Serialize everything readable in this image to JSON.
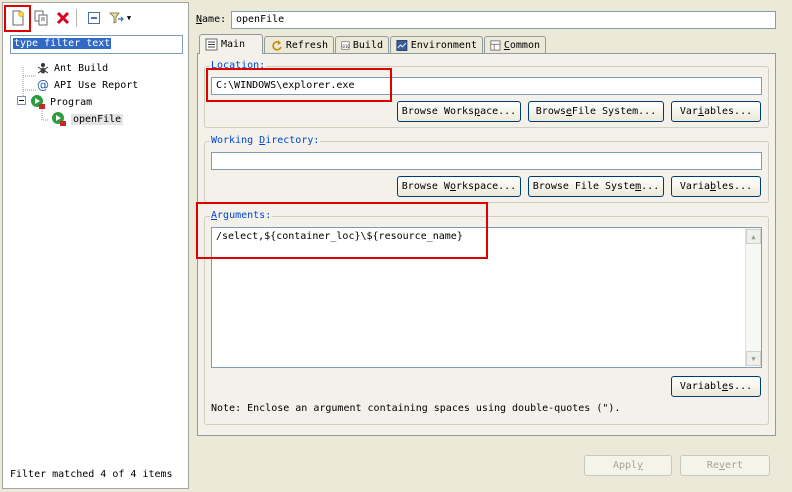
{
  "left": {
    "filter_placeholder": "type filter text",
    "tree": {
      "ant_build": "Ant Build",
      "api_use_report": "API Use Report",
      "program": "Program",
      "open_file": "openFile"
    },
    "status": "Filter matched 4 of 4 items"
  },
  "name": {
    "label_pre": "N",
    "label_post": "ame:",
    "value": "openFile"
  },
  "tabs": {
    "main": "Main",
    "refresh": "Refresh",
    "build": "Build",
    "environment": "Environment",
    "common_pre": "C",
    "common_post": "ommon"
  },
  "location": {
    "title_pre": "L",
    "title_post": "ocation:",
    "value": "C:\\WINDOWS\\explorer.exe",
    "btn_workspace_pre": "Browse Works",
    "btn_workspace_u": "p",
    "btn_workspace_post": "ace...",
    "btn_filesystem_pre": "Brows",
    "btn_filesystem_u": "e",
    "btn_filesystem_post": " File System...",
    "btn_variables_pre": "Var",
    "btn_variables_u": "i",
    "btn_variables_post": "ables..."
  },
  "working_dir": {
    "title_pre": "Working ",
    "title_u": "D",
    "title_post": "irectory:",
    "value": "",
    "btn_workspace_pre": "Browse W",
    "btn_workspace_u": "o",
    "btn_workspace_post": "rkspace...",
    "btn_filesystem_pre": "Browse File Syste",
    "btn_filesystem_u": "m",
    "btn_filesystem_post": "...",
    "btn_variables_pre": "Varia",
    "btn_variables_u": "b",
    "btn_variables_post": "les..."
  },
  "arguments": {
    "title_pre": "A",
    "title_post": "rguments:",
    "value": "/select,${container_loc}\\${resource_name}",
    "btn_variables_pre": "Variabl",
    "btn_variables_u": "e",
    "btn_variables_post": "s...",
    "note": "Note: Enclose an argument containing spaces using double-quotes (\")."
  },
  "footer": {
    "apply_pre": "Appl",
    "apply_u": "y",
    "apply_post": "",
    "revert_pre": "Re",
    "revert_u": "v",
    "revert_post": "ert"
  }
}
